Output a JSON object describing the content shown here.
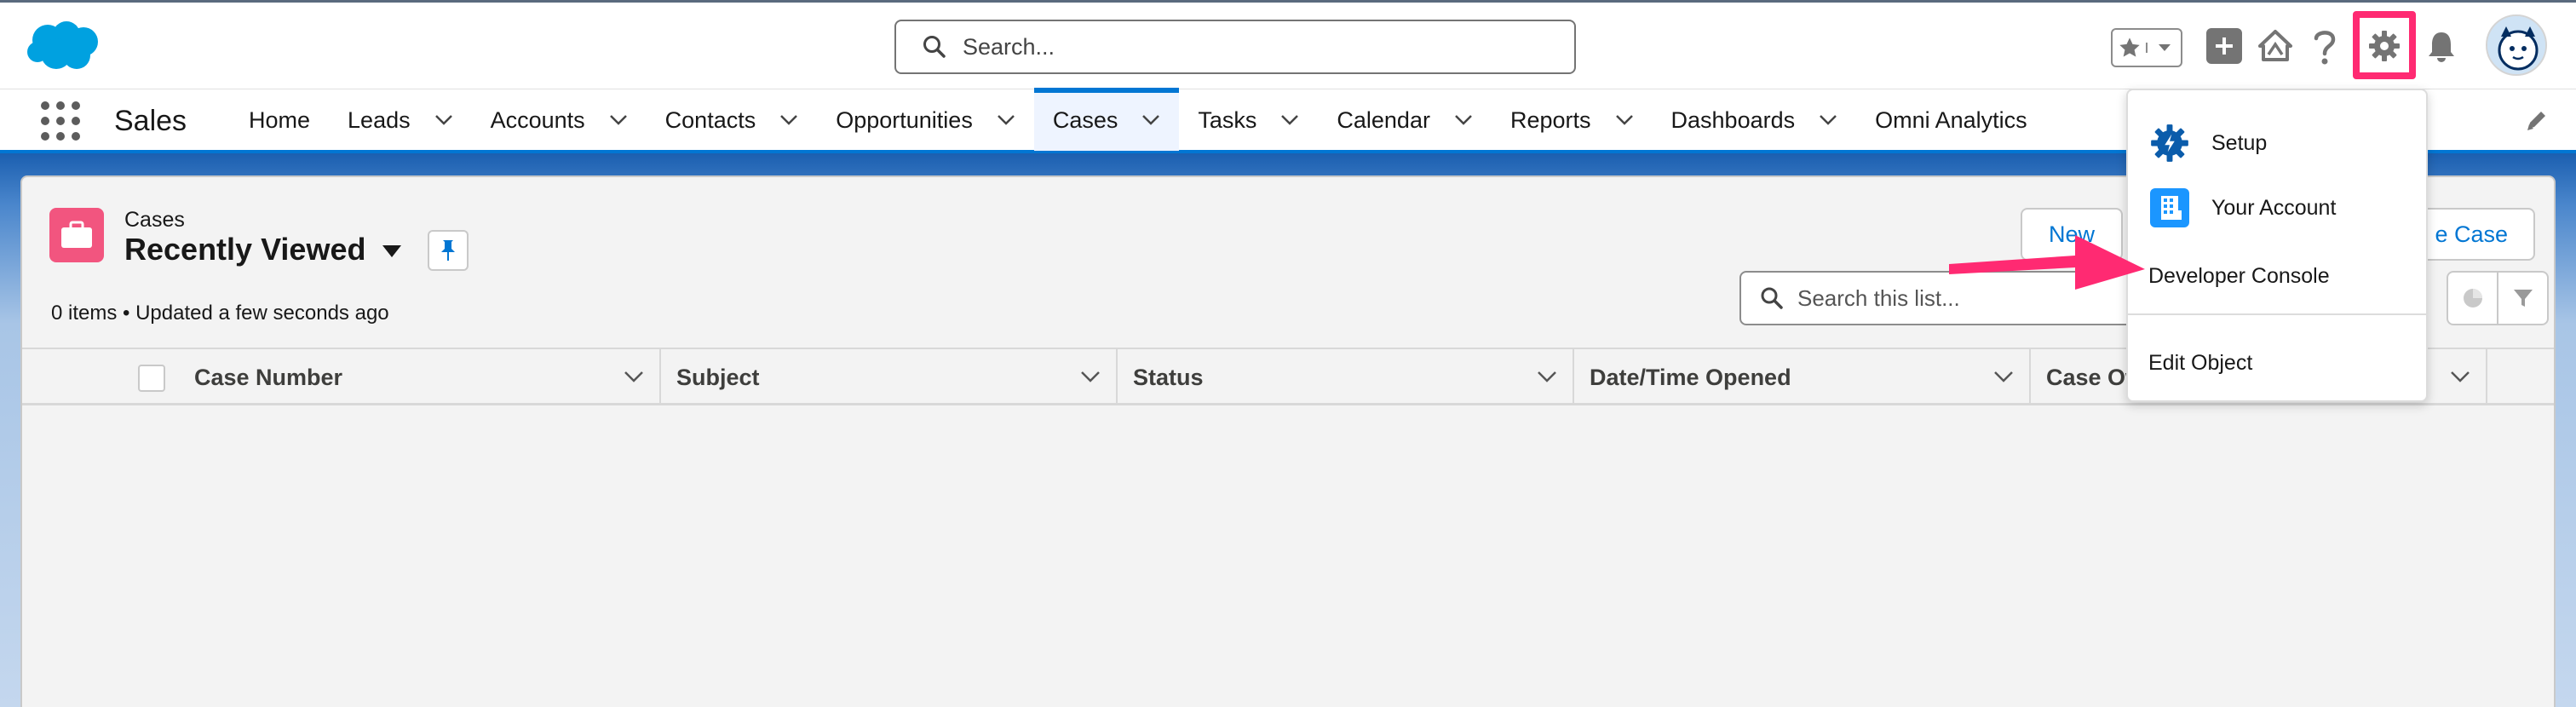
{
  "header": {
    "search_placeholder": "Search...",
    "icons": [
      "salesforce-cloud-logo",
      "star-icon",
      "chevron-down-icon",
      "plus-icon",
      "trailhead-icon",
      "help-icon",
      "gear-icon",
      "bell-icon",
      "avatar"
    ],
    "highlight_color": "#ff2a72"
  },
  "nav": {
    "app_name": "Sales",
    "items": [
      {
        "label": "Home",
        "has_menu": false
      },
      {
        "label": "Leads",
        "has_menu": true
      },
      {
        "label": "Accounts",
        "has_menu": true
      },
      {
        "label": "Contacts",
        "has_menu": true
      },
      {
        "label": "Opportunities",
        "has_menu": true
      },
      {
        "label": "Cases",
        "has_menu": true,
        "active": true
      },
      {
        "label": "Tasks",
        "has_menu": true
      },
      {
        "label": "Calendar",
        "has_menu": true
      },
      {
        "label": "Reports",
        "has_menu": true
      },
      {
        "label": "Dashboards",
        "has_menu": true
      },
      {
        "label": "Omni Analytics",
        "has_menu": false
      }
    ],
    "accent_color": "#0176d3"
  },
  "list_view": {
    "object_label": "Cases",
    "title": "Recently Viewed",
    "meta": "0 items • Updated a few seconds ago",
    "new_button": "New",
    "case_button": "e Case",
    "search_placeholder": "Search this list...",
    "columns": [
      "Case Number",
      "Subject",
      "Status",
      "Date/Time Opened",
      "Case Owr"
    ],
    "object_icon_color": "#f2557f"
  },
  "settings_menu": {
    "items": [
      "Setup",
      "Your Account",
      "Developer Console",
      "Edit Object"
    ]
  }
}
